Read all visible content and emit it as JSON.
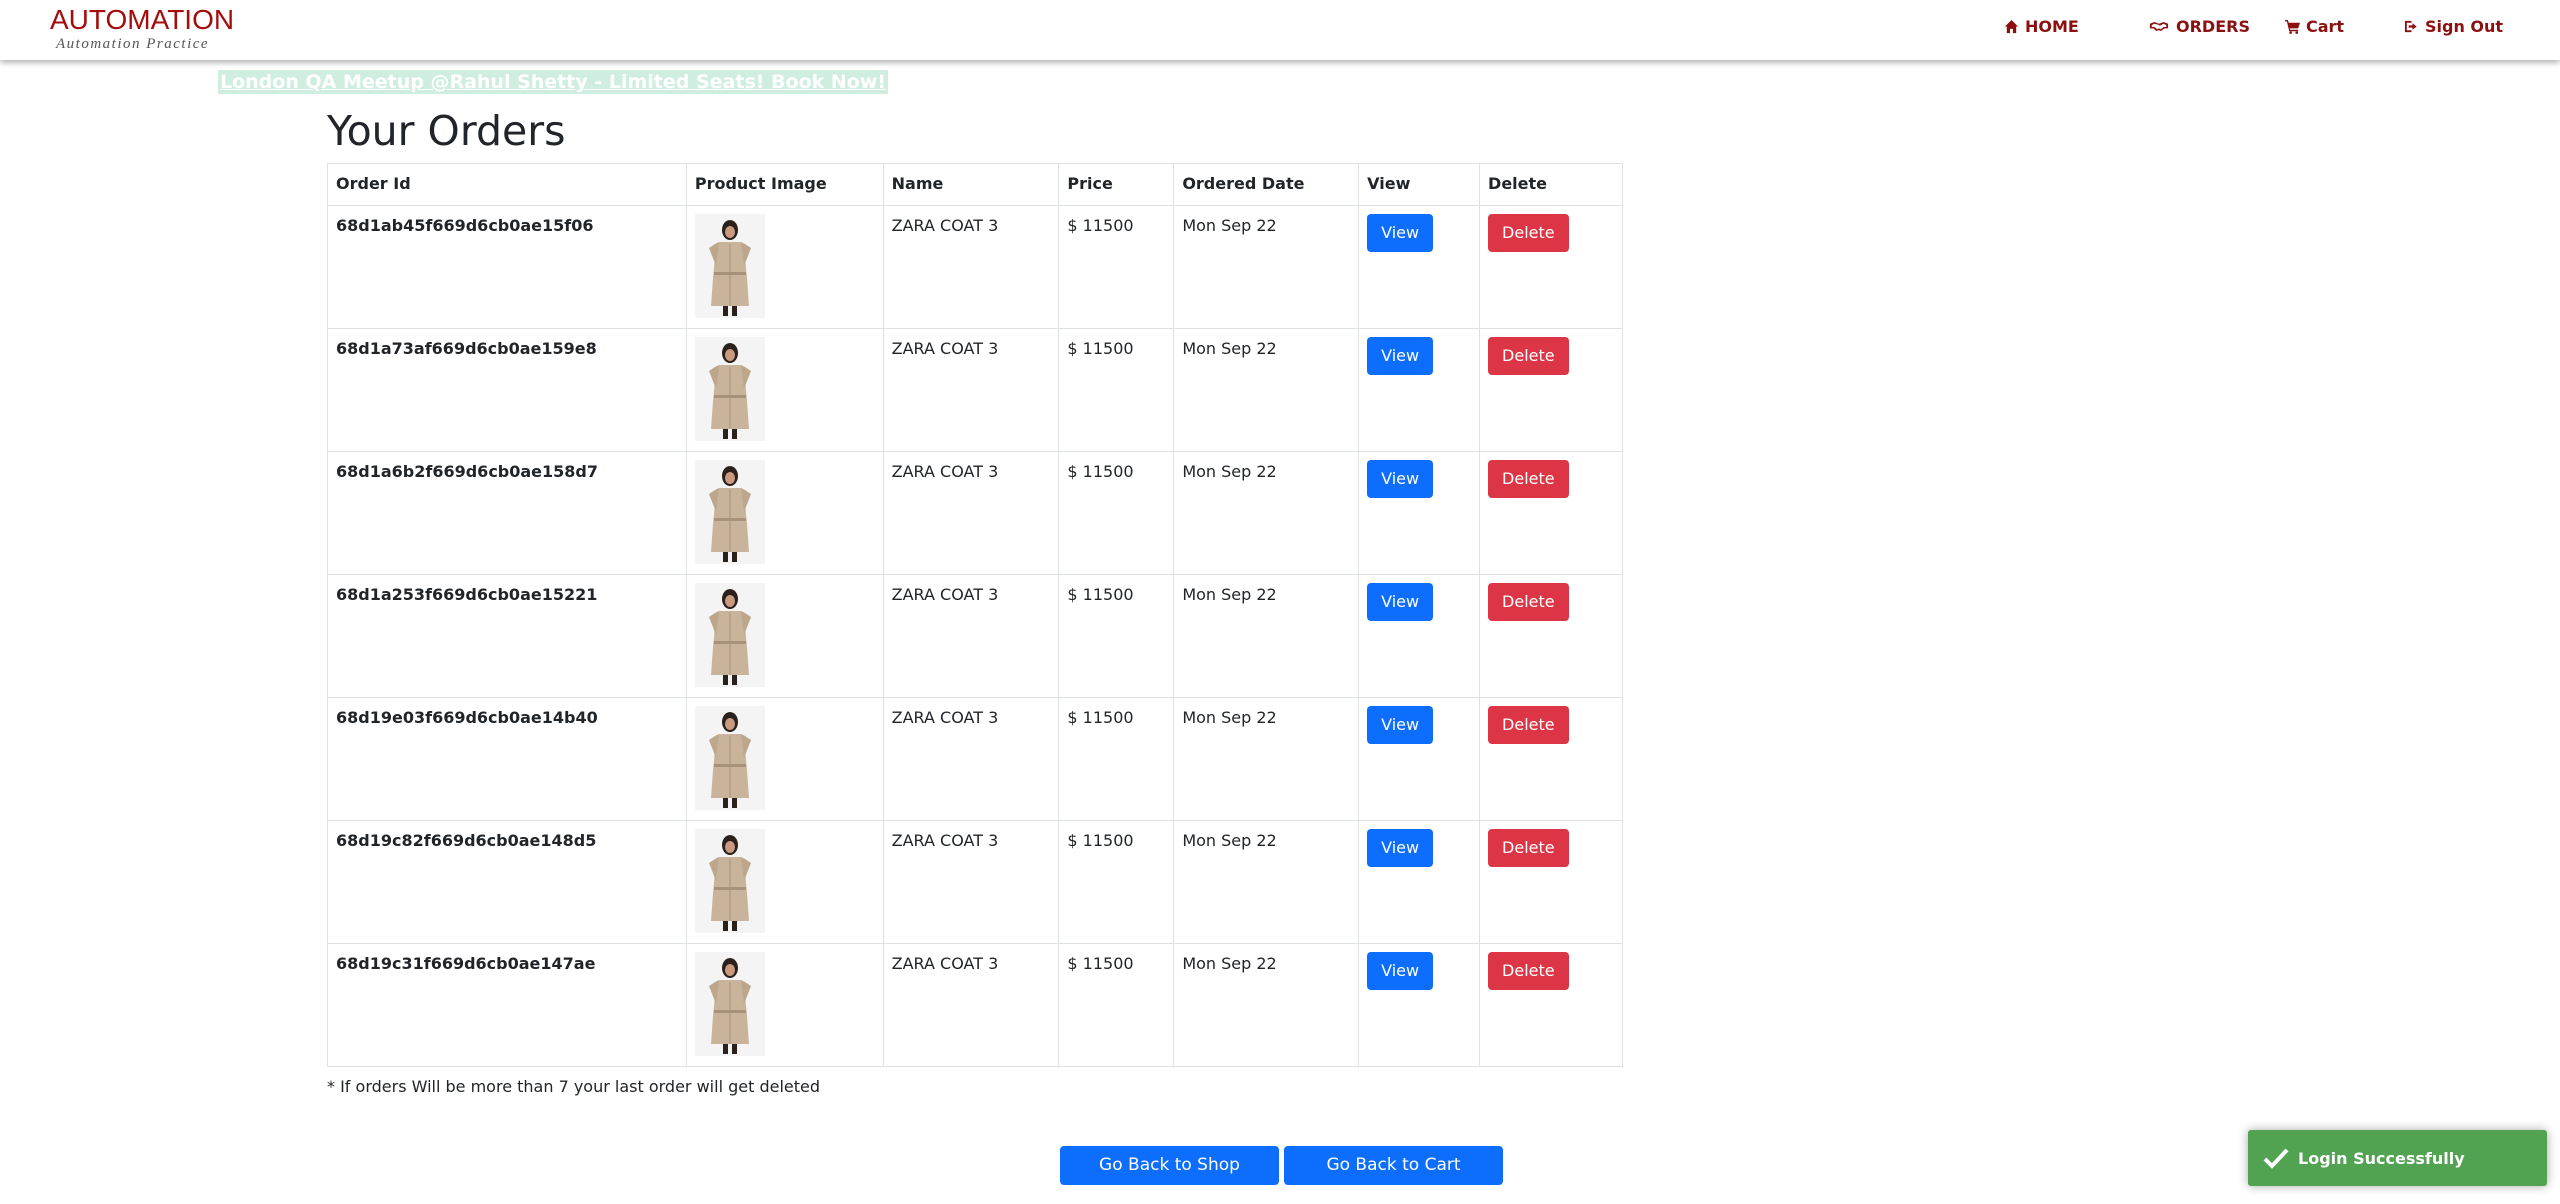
{
  "header": {
    "brand_title": "AUTOMATION",
    "brand_subtitle": "Automation Practice",
    "nav": {
      "home": "HOME",
      "orders": "ORDERS",
      "cart": "Cart",
      "signout": "Sign Out"
    },
    "brand_color": "#a50d0d"
  },
  "promo": {
    "text": "London QA Meetup @Rahul Shetty - Limited Seats! Book Now!"
  },
  "page_title": "Your Orders",
  "table": {
    "headers": [
      "Order Id",
      "Product Image",
      "Name",
      "Price",
      "Ordered Date",
      "View",
      "Delete"
    ],
    "rows": [
      {
        "order_id": "68d1ab45f669d6cb0ae15f06",
        "name": "ZARA COAT 3",
        "price": "$ 11500",
        "date": "Mon Sep 22",
        "view": "View",
        "delete": "Delete"
      },
      {
        "order_id": "68d1a73af669d6cb0ae159e8",
        "name": "ZARA COAT 3",
        "price": "$ 11500",
        "date": "Mon Sep 22",
        "view": "View",
        "delete": "Delete"
      },
      {
        "order_id": "68d1a6b2f669d6cb0ae158d7",
        "name": "ZARA COAT 3",
        "price": "$ 11500",
        "date": "Mon Sep 22",
        "view": "View",
        "delete": "Delete"
      },
      {
        "order_id": "68d1a253f669d6cb0ae15221",
        "name": "ZARA COAT 3",
        "price": "$ 11500",
        "date": "Mon Sep 22",
        "view": "View",
        "delete": "Delete"
      },
      {
        "order_id": "68d19e03f669d6cb0ae14b40",
        "name": "ZARA COAT 3",
        "price": "$ 11500",
        "date": "Mon Sep 22",
        "view": "View",
        "delete": "Delete"
      },
      {
        "order_id": "68d19c82f669d6cb0ae148d5",
        "name": "ZARA COAT 3",
        "price": "$ 11500",
        "date": "Mon Sep 22",
        "view": "View",
        "delete": "Delete"
      },
      {
        "order_id": "68d19c31f669d6cb0ae147ae",
        "name": "ZARA COAT 3",
        "price": "$ 11500",
        "date": "Mon Sep 22",
        "view": "View",
        "delete": "Delete"
      }
    ]
  },
  "note": "* If orders Will be more than 7 your last order will get deleted",
  "buttons": {
    "back_to_shop": "Go Back to Shop",
    "back_to_cart": "Go Back to Cart"
  },
  "toast": {
    "message": "Login Successfully",
    "color": "#51a351"
  },
  "colors": {
    "primary": "#0d6efd",
    "danger": "#dc3545",
    "nav_text": "#8b1111"
  }
}
